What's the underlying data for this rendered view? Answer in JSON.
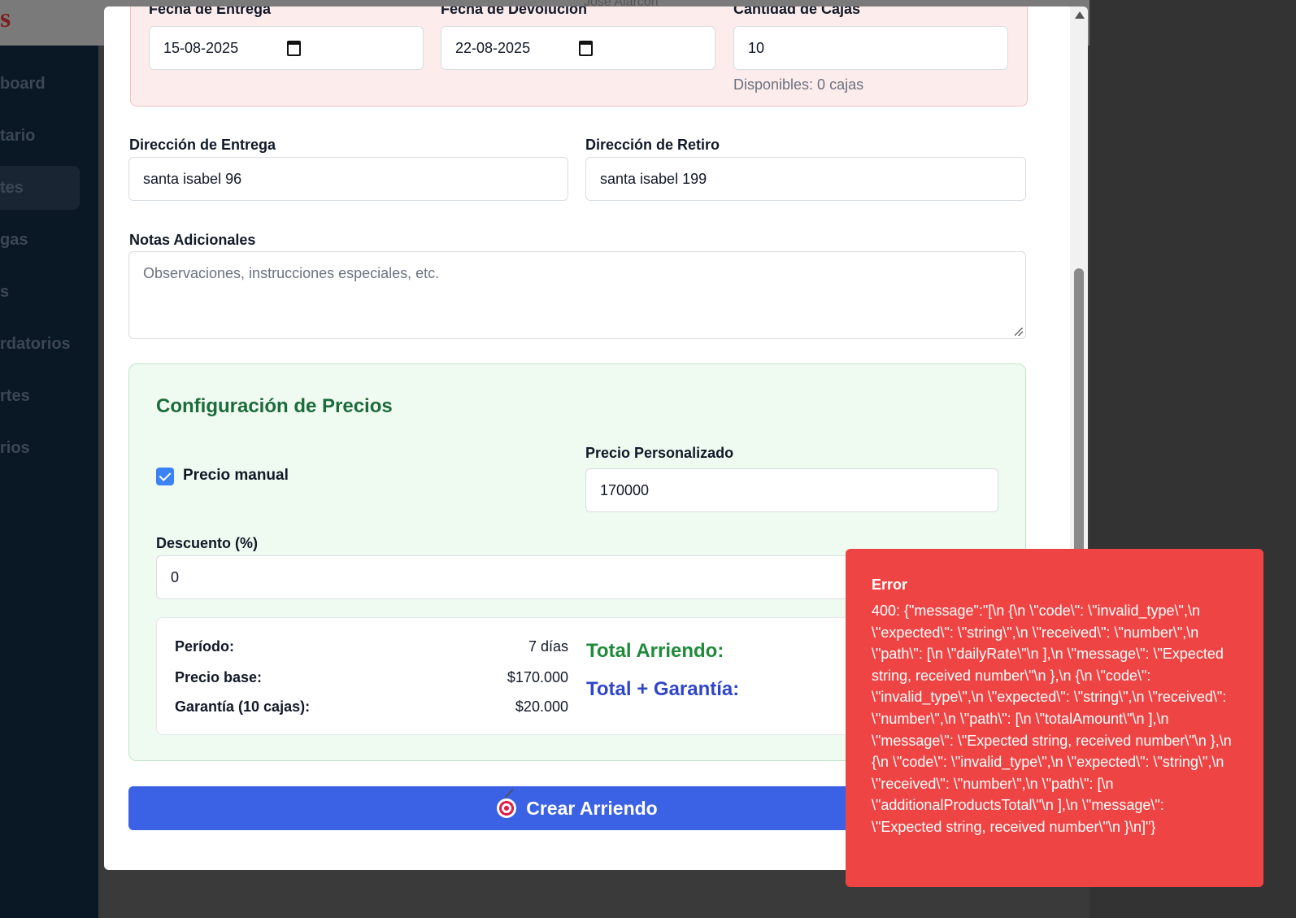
{
  "background": {
    "logo": "s",
    "user_name": "Jose Alarcón",
    "nav_items": [
      "board",
      "tario",
      "tes",
      "gas",
      "s",
      "rdatorios",
      "rtes",
      "rios"
    ]
  },
  "modal": {
    "fields": {
      "delivery_date": {
        "label": "Fecha de Entrega",
        "value": "15-08-2025"
      },
      "return_date": {
        "label": "Fecha de Devolución",
        "value": "22-08-2025"
      },
      "box_qty": {
        "label": "Cantidad de Cajas",
        "value": "10",
        "help": "Disponibles: 0 cajas"
      },
      "delivery_address": {
        "label": "Dirección de Entrega",
        "value": "santa isabel 96"
      },
      "pickup_address": {
        "label": "Dirección de Retiro",
        "value": "santa isabel 199"
      },
      "notes": {
        "label": "Notas Adicionales",
        "placeholder": "Observaciones, instrucciones especiales, etc."
      }
    },
    "pricing": {
      "title": "Configuración de Precios",
      "manual_label": "Precio manual",
      "manual_checked": true,
      "custom_price_label": "Precio Personalizado",
      "custom_price_value": "170000",
      "discount_label": "Descuento (%)",
      "discount_value": "0"
    },
    "summary": {
      "period_label": "Período:",
      "period_value": "7 días",
      "base_label": "Precio base:",
      "base_value": "$170.000",
      "guarantee_label": "Garantía (10 cajas):",
      "guarantee_value": "$20.000",
      "total_rent_label": "Total Arriendo:",
      "total_guarantee_label": "Total + Garantía:"
    },
    "create_button": "Crear Arriendo"
  },
  "toast": {
    "title": "Error",
    "message": "400: {\"message\":\"[\\n {\\n \\\"code\\\": \\\"invalid_type\\\",\\n \\\"expected\\\": \\\"string\\\",\\n \\\"received\\\": \\\"number\\\",\\n \\\"path\\\": [\\n \\\"dailyRate\\\"\\n ],\\n \\\"message\\\": \\\"Expected string, received number\\\"\\n },\\n {\\n \\\"code\\\": \\\"invalid_type\\\",\\n \\\"expected\\\": \\\"string\\\",\\n \\\"received\\\": \\\"number\\\",\\n \\\"path\\\": [\\n \\\"totalAmount\\\"\\n ],\\n \\\"message\\\": \\\"Expected string, received number\\\"\\n },\\n {\\n \\\"code\\\": \\\"invalid_type\\\",\\n \\\"expected\\\": \\\"string\\\",\\n \\\"received\\\": \\\"number\\\",\\n \\\"path\\\": [\\n \\\"additionalProductsTotal\\\"\\n ],\\n \\\"message\\\": \\\"Expected string, received number\\\"\\n }\\n]\"}"
  }
}
